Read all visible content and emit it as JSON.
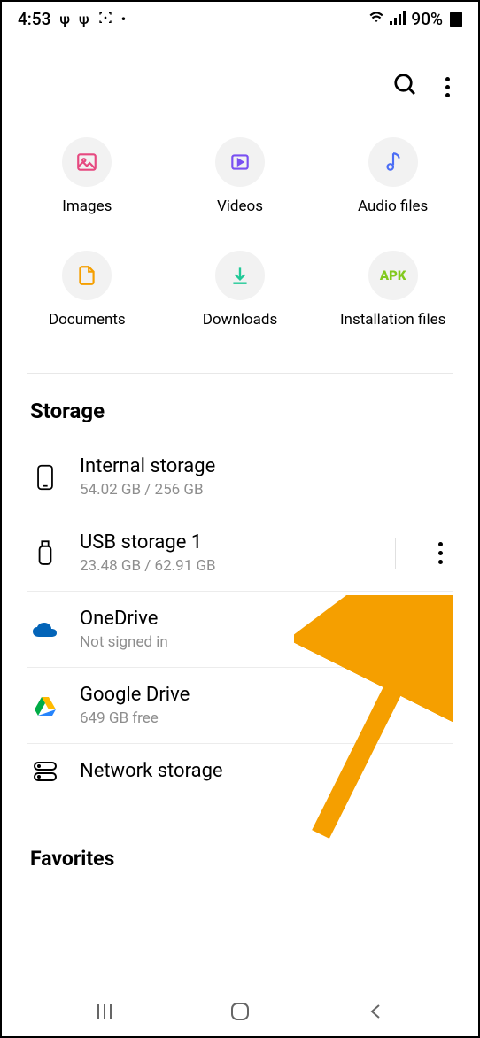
{
  "status": {
    "time": "4:53",
    "battery": "90%"
  },
  "categories": [
    {
      "label": "Images"
    },
    {
      "label": "Videos"
    },
    {
      "label": "Audio files"
    },
    {
      "label": "Documents"
    },
    {
      "label": "Downloads"
    },
    {
      "label": "Installation files"
    }
  ],
  "storage": {
    "title": "Storage",
    "items": [
      {
        "name": "Internal storage",
        "detail": "54.02 GB / 256 GB"
      },
      {
        "name": "USB storage 1",
        "detail": "23.48 GB / 62.91 GB"
      },
      {
        "name": "OneDrive",
        "detail": "Not signed in"
      },
      {
        "name": "Google Drive",
        "detail": "649 GB free"
      },
      {
        "name": "Network storage",
        "detail": ""
      }
    ]
  },
  "favorites": {
    "title": "Favorites"
  },
  "apk_text": "APK"
}
